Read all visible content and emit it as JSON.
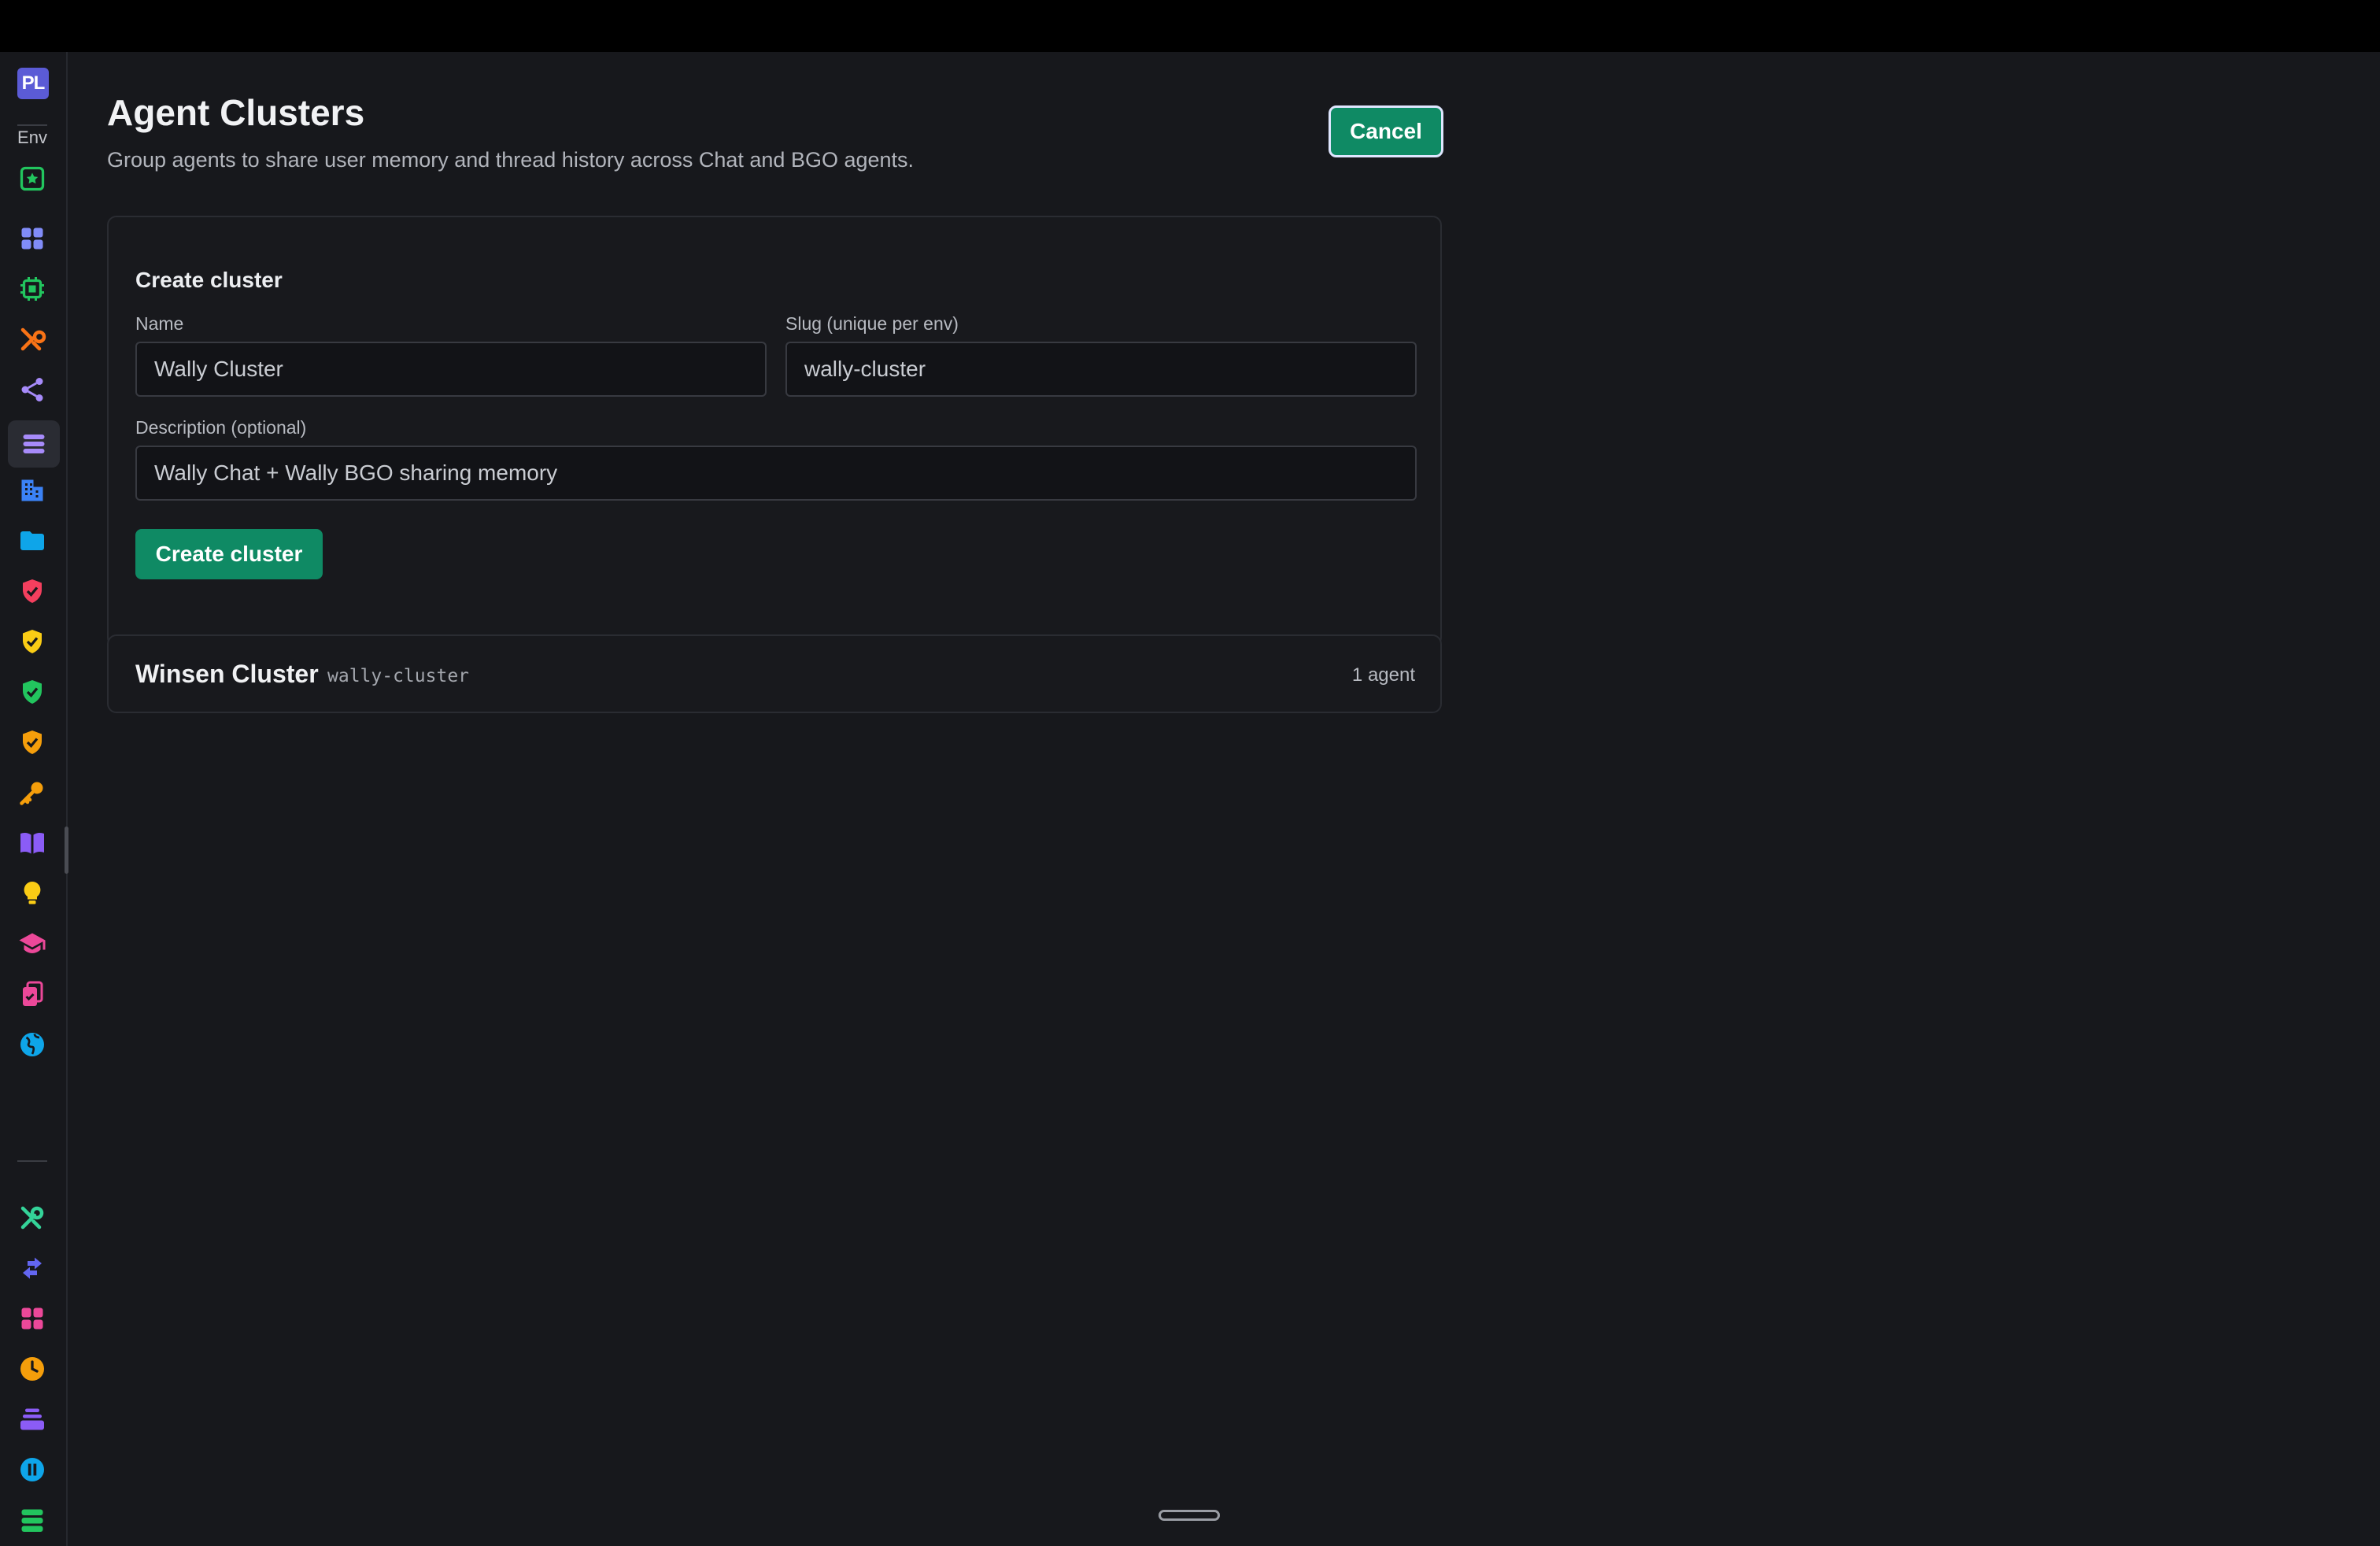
{
  "sidebar": {
    "logo_text": "PL",
    "env_label": "Env",
    "icons": [
      {
        "name": "environment-star-icon",
        "color": "#22c55e"
      },
      {
        "name": "grid-icon",
        "color": "#818cf8"
      },
      {
        "name": "chip-icon",
        "color": "#22c55e"
      },
      {
        "name": "tools-icon",
        "color": "#f97316"
      },
      {
        "name": "share-icon",
        "color": "#a78bfa"
      },
      {
        "name": "stack-icon",
        "color": "#a78bfa"
      },
      {
        "name": "building-icon",
        "color": "#3b82f6"
      },
      {
        "name": "folder-icon",
        "color": "#0ea5e9"
      },
      {
        "name": "shield-red-icon",
        "color": "#f43f5e"
      },
      {
        "name": "shield-yellow-icon",
        "color": "#facc15"
      },
      {
        "name": "shield-green-icon",
        "color": "#22c55e"
      },
      {
        "name": "shield-orange-icon",
        "color": "#f59e0b"
      },
      {
        "name": "key-icon",
        "color": "#f59e0b"
      },
      {
        "name": "book-icon",
        "color": "#8b5cf6"
      },
      {
        "name": "lightbulb-icon",
        "color": "#facc15"
      },
      {
        "name": "graduation-cap-icon",
        "color": "#ec4899"
      },
      {
        "name": "checklist-icon",
        "color": "#ec4899"
      },
      {
        "name": "globe-icon",
        "color": "#0ea5e9"
      },
      {
        "name": "wrench-icon",
        "color": "#34d399"
      },
      {
        "name": "arrows-icon",
        "color": "#6366f1"
      },
      {
        "name": "apps-icon",
        "color": "#ec4899"
      },
      {
        "name": "clock-icon",
        "color": "#f59e0b"
      },
      {
        "name": "layers-icon",
        "color": "#8b5cf6"
      },
      {
        "name": "pause-icon",
        "color": "#0ea5e9"
      },
      {
        "name": "server-icon",
        "color": "#22c55e"
      }
    ]
  },
  "header": {
    "title": "Agent Clusters",
    "subtitle": "Group agents to share user memory and thread history across Chat and BGO agents.",
    "cancel_label": "Cancel"
  },
  "create_form": {
    "title": "Create cluster",
    "name_label": "Name",
    "name_value": "Wally Cluster",
    "slug_label": "Slug (unique per env)",
    "slug_value": "wally-cluster",
    "description_label": "Description (optional)",
    "description_value": "Wally Chat + Wally BGO sharing memory",
    "submit_label": "Create cluster"
  },
  "clusters": [
    {
      "name": "Winsen Cluster",
      "slug": "wally-cluster",
      "agent_count": "1 agent"
    }
  ],
  "colors": {
    "background": "#17181c",
    "accent_green": "#0f8a64",
    "logo_indigo": "#5b5bd6"
  }
}
